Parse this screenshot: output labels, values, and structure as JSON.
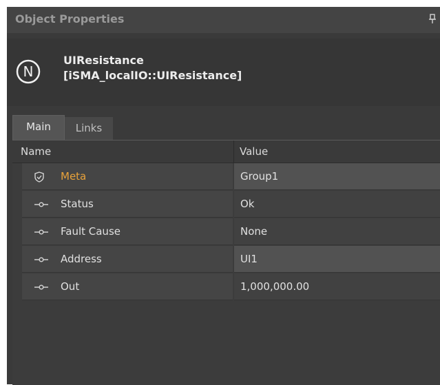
{
  "panel": {
    "title": "Object Properties",
    "pin_icon": "pin-icon"
  },
  "object": {
    "icon_letter": "N",
    "name": "UIResistance",
    "type": "[iSMA_localIO::UIResistance]"
  },
  "tabs": [
    {
      "label": "Main",
      "active": true
    },
    {
      "label": "Links",
      "active": false
    }
  ],
  "grid": {
    "columns": {
      "name": "Name",
      "value": "Value"
    },
    "rows": [
      {
        "label": "Meta",
        "value": "Group1",
        "icon": "shield-check-icon",
        "highlight": true,
        "editable": true
      },
      {
        "label": "Status",
        "value": "Ok",
        "icon": "slot-connector-icon",
        "highlight": false,
        "editable": false
      },
      {
        "label": "Fault Cause",
        "value": "None",
        "icon": "slot-connector-icon",
        "highlight": false,
        "editable": false
      },
      {
        "label": "Address",
        "value": "UI1",
        "icon": "slot-connector-icon",
        "highlight": false,
        "editable": true
      },
      {
        "label": "Out",
        "value": "1,000,000.00",
        "icon": "slot-connector-icon",
        "highlight": false,
        "editable": false
      }
    ]
  },
  "colors": {
    "meta_accent": "#e8a23a",
    "panel_bg": "#3a3a3a"
  }
}
